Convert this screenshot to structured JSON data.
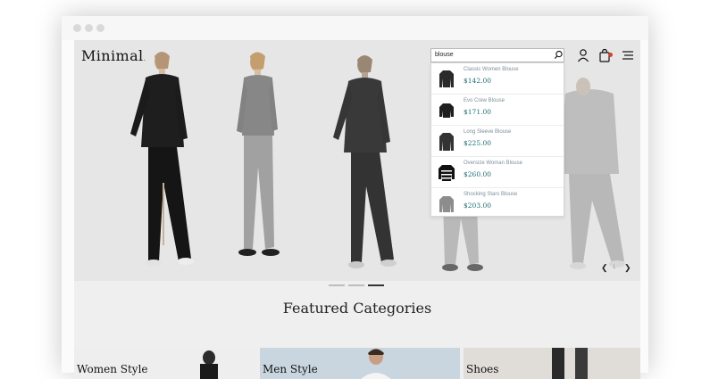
{
  "header": {
    "logo": "Minimal",
    "logo_mark": "."
  },
  "search": {
    "query": "blouse",
    "results": [
      {
        "name": "Classic Women Blouse",
        "price": "$142.00",
        "icon": "sweater-thumbnail"
      },
      {
        "name": "Evo Crew Blouse",
        "price": "$171.00",
        "icon": "sweater-thumbnail"
      },
      {
        "name": "Long Sleeve Blouse",
        "price": "$225.00",
        "icon": "sweater-thumbnail"
      },
      {
        "name": "Oversize Woman Blouse",
        "price": "$260.00",
        "icon": "striped-sweater-thumbnail"
      },
      {
        "name": "Shocking Stars Blouse",
        "price": "$203.00",
        "icon": "sweater-thumbnail"
      }
    ]
  },
  "slider": {
    "counter": "1",
    "dots": 3,
    "active_dot": 3
  },
  "featured": {
    "title": "Featured Categories",
    "categories": [
      {
        "label": "Women Style"
      },
      {
        "label": "Men Style"
      },
      {
        "label": "Shoes"
      }
    ]
  },
  "colors": {
    "price": "#1f6b72",
    "product_name": "#7d8f9a",
    "hero_bg": "#ebebeb"
  }
}
